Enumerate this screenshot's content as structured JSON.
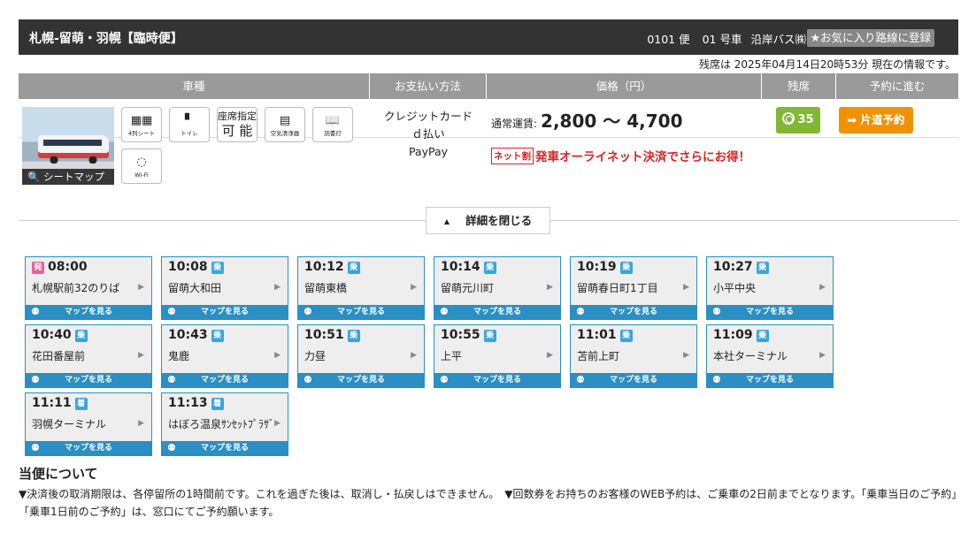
{
  "header": {
    "route_title": "札幌-留萌・羽幌【臨時便】",
    "bin_no": "0101 便",
    "car_no": "01 号車",
    "operator": "沿岸バス㈱",
    "favorite_label": "★お気に入り路線に登録"
  },
  "status_text": "残席は 2025年04月14日20時53分 現在の情報です。",
  "table_head": [
    "車種",
    "お支払い方法",
    "価格（円）",
    "残席",
    "予約に進む"
  ],
  "vehicle": {
    "seat_map_label": "シートマップ",
    "features": [
      {
        "icon": "seat-4row-icon",
        "label": "4列シート"
      },
      {
        "icon": "toilet-icon",
        "label": "トイレ"
      },
      {
        "icon": "reserved-seat-icon",
        "label": "座席指定可能"
      },
      {
        "icon": "air-purifier-icon",
        "label": "空気清浄器"
      },
      {
        "icon": "reading-light-icon",
        "label": "読書灯"
      },
      {
        "icon": "wifi-icon",
        "label": "Wi-Fi"
      }
    ],
    "reserved_text_1": "座席指定",
    "reserved_text_2": "可 能"
  },
  "payment": [
    "クレジットカード",
    "ｄ払い",
    "PayPay"
  ],
  "price": {
    "label": "通常運賃:",
    "value": "2,800 ～ 4,700",
    "net_tag": "ネット割",
    "promo": "発車オーライネット決済でさらにお得！"
  },
  "seats_left": "35",
  "reserve_label": "➡ 片道予約",
  "close_detail_label": "詳細を閉じる",
  "badges": {
    "dep": "発",
    "board": "乗",
    "alight": "着"
  },
  "map_label": "マップを見る",
  "stops": [
    {
      "time": "08:00",
      "name": "札幌駅前32のりば",
      "type": "dep"
    },
    {
      "time": "10:08",
      "name": "留萌大和田",
      "type": "board"
    },
    {
      "time": "10:12",
      "name": "留萌東橋",
      "type": "board"
    },
    {
      "time": "10:14",
      "name": "留萌元川町",
      "type": "board"
    },
    {
      "time": "10:19",
      "name": "留萌春日町1丁目",
      "type": "board"
    },
    {
      "time": "10:27",
      "name": "小平中央",
      "type": "board"
    },
    {
      "time": "10:40",
      "name": "花田番屋前",
      "type": "board"
    },
    {
      "time": "10:43",
      "name": "鬼鹿",
      "type": "board"
    },
    {
      "time": "10:51",
      "name": "力昼",
      "type": "board"
    },
    {
      "time": "10:55",
      "name": "上平",
      "type": "board"
    },
    {
      "time": "11:01",
      "name": "苫前上町",
      "type": "board"
    },
    {
      "time": "11:09",
      "name": "本社ターミナル",
      "type": "board"
    },
    {
      "time": "11:11",
      "name": "羽幌ターミナル",
      "type": "alight"
    },
    {
      "time": "11:13",
      "name": "はぼろ温泉ｻﾝｾｯﾄﾌﾟﾗｻﾞ",
      "type": "alight"
    }
  ],
  "about": {
    "title": "当便について",
    "note": "▼決済後の取消期限は、各停留所の1時間前です。これを過ぎた後は、取消し・払戻しはできません。　▼回数券をお持ちのお客様のWEB予約は、ご乗車の2日前までとなります。「乗車当日のご予約」「乗車1日前のご予約」は、窓口にてご予約願います。"
  }
}
